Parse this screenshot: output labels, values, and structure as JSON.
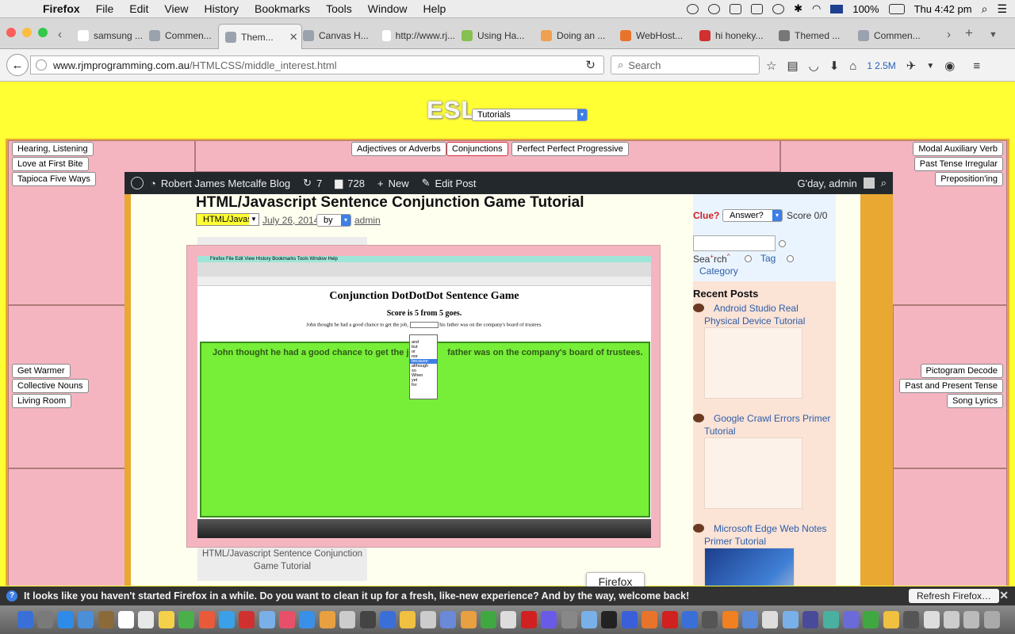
{
  "menubar": {
    "items": [
      "Firefox",
      "File",
      "Edit",
      "View",
      "History",
      "Bookmarks",
      "Tools",
      "Window",
      "Help"
    ],
    "battery": "100%",
    "clock": "Thu 4:42 pm"
  },
  "tabs": [
    {
      "label": "samsung ...",
      "color": "#ffffff"
    },
    {
      "label": "Commen...",
      "color": "#9aa3ad"
    },
    {
      "label": "Them...",
      "color": "#9aa3ad"
    },
    {
      "label": "Canvas H...",
      "color": "#9aa3ad"
    },
    {
      "label": "http://www.rj...",
      "color": "#ffffff"
    },
    {
      "label": "Using Ha...",
      "color": "#86c050"
    },
    {
      "label": "Doing an ...",
      "color": "#f0a050"
    },
    {
      "label": "WebHost...",
      "color": "#e8742c"
    },
    {
      "label": "hi honeky...",
      "color": "#d03030"
    },
    {
      "label": "Themed ...",
      "color": "#777777"
    },
    {
      "label": "Commen...",
      "color": "#9aa3ad"
    }
  ],
  "navbar": {
    "url_host": "www.rjmprogramming.com.au",
    "url_path": "/HTMLCSS/middle_interest.html",
    "search_placeholder": "Search",
    "pocket_count": "1",
    "size_label": "2.5M"
  },
  "page": {
    "logo": "ESL",
    "tutorials_select": "Tutorials",
    "top_buttons": [
      "Adjectives or Adverbs",
      "Conjunctions",
      "Perfect Perfect Progressive"
    ],
    "left_buttons_top": [
      "Hearing, Listening",
      "Love at First Bite",
      "Tapioca Five Ways"
    ],
    "left_buttons_mid": [
      "Get Warmer",
      "Collective Nouns",
      "Living Room"
    ],
    "right_buttons_top": [
      "Modal Auxiliary Verb",
      "Past Tense Irregular",
      "Preposition'ing"
    ],
    "right_buttons_mid": [
      "Pictogram Decode",
      "Past and Present Tense",
      "Song Lyrics"
    ]
  },
  "wpbar": {
    "site": "Robert James Metcalfe Blog",
    "updates": "7",
    "comments": "728",
    "new_label": "New",
    "edit_label": "Edit Post",
    "greeting": "G'day, admin"
  },
  "post": {
    "title": "HTML/Javascript Sentence Conjunction Game Tutorial",
    "category": "HTML/Javascript",
    "date": "July 26, 2014",
    "by_select": "by",
    "author": "admin",
    "caption": "HTML/Javascript Sentence Conjunction Game Tutorial"
  },
  "shot": {
    "menu": "Firefox   File   Edit   View   History   Bookmarks   Tools   Window   Help",
    "title": "Conjunction DotDotDot Sentence Game",
    "score": "Score is 5 from 5 goes.",
    "sentence_a": "John thought he had a good chance to get the job,",
    "sentence_b": "his father was on the company's board of trustees.",
    "green_a": "John thought he had a good chance to get the job,",
    "green_b": "father was on the company's board of trustees.",
    "options": [
      "and",
      "but",
      "or",
      "nor",
      "because",
      "although",
      "so",
      "When",
      "yet",
      "for"
    ],
    "selected_option": "because"
  },
  "sidebar": {
    "clue_label": "Clue?",
    "answer_select": "Answer?",
    "score": "Score 0/0",
    "search_label_a": "Sea",
    "search_label_b": "rch",
    "tag_label": "Tag",
    "category_label": "Category",
    "recent_heading": "Recent Posts",
    "recent": [
      "Android Studio Real Physical Device Tutorial",
      "Google Crawl Errors Primer Tutorial",
      "Microsoft Edge Web Notes Primer Tutorial"
    ]
  },
  "tooltip": "Firefox",
  "notification": {
    "text": "It looks like you haven't started Firefox in a while. Do you want to clean it up for a fresh, like-new experience? And by the way, welcome back!",
    "button": "Refresh Firefox…"
  },
  "dock_colors": [
    "#3a6fd8",
    "#7a7a7a",
    "#2f8ae8",
    "#4a8fd8",
    "#8b6a3a",
    "#ffffff",
    "#e8e8e8",
    "#f5d14a",
    "#4ab04a",
    "#e85a3a",
    "#3aa0e8",
    "#d03030",
    "#7ab0e8",
    "#e8506a",
    "#3a90e8",
    "#e8a040",
    "#cccccc",
    "#444444",
    "#3a6fd8",
    "#f0c040",
    "#cccccc",
    "#6a8ad8",
    "#e8a040",
    "#40a840",
    "#dddddd",
    "#d02020",
    "#6a5ae8",
    "#888888",
    "#7ab0e8",
    "#222222",
    "#3a5fd8",
    "#e8742c",
    "#d02020",
    "#3a6fd8",
    "#555555",
    "#f08020",
    "#5a8ad8",
    "#dddddd",
    "#7ab0e8",
    "#4a4a9a",
    "#4ab0a0",
    "#6a6ad8",
    "#40a840",
    "#f0c040",
    "#555555",
    "#dddddd",
    "#cccccc",
    "#bbbbbb",
    "#aaaaaa"
  ]
}
